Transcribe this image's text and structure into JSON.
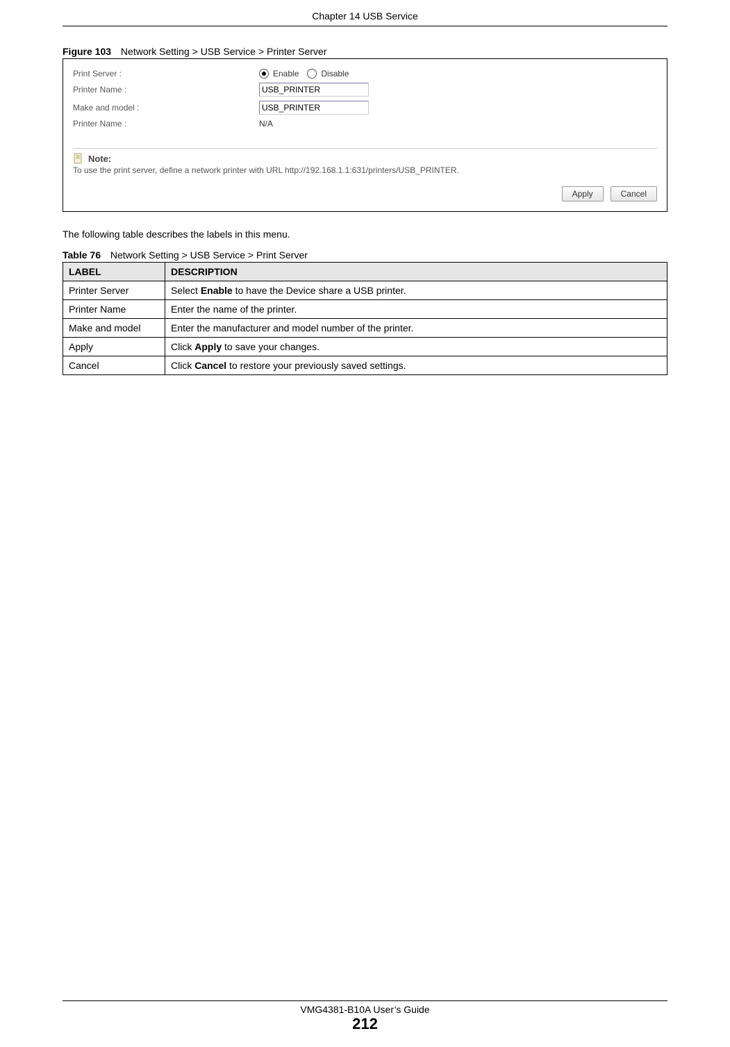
{
  "header": {
    "chapter_title": "Chapter 14 USB Service"
  },
  "figure_caption": {
    "label": "Figure 103",
    "text": "Network Setting > USB Service > Printer Server"
  },
  "form": {
    "row1_label": "Print Server :",
    "radio_enable": "Enable",
    "radio_disable": "Disable",
    "row2_label": "Printer Name :",
    "row2_value": "USB_PRINTER",
    "row3_label": "Make and model :",
    "row3_value": "USB_PRINTER",
    "row4_label": "Printer Name :",
    "row4_value": "N/A"
  },
  "note": {
    "heading": "Note:",
    "text": "To use the print server, define a network printer with URL http://192.168.1.1:631/printers/USB_PRINTER."
  },
  "buttons": {
    "apply": "Apply",
    "cancel": "Cancel"
  },
  "para": "The following table describes the labels in this menu.",
  "table_caption": {
    "label": "Table 76",
    "text": "Network Setting > USB Service > Print Server"
  },
  "table": {
    "head_label": "LABEL",
    "head_desc": "DESCRIPTION",
    "rows": [
      {
        "label": "Printer Server",
        "desc_pre": "Select ",
        "desc_bold": "Enable",
        "desc_post": " to have the Device share a USB printer."
      },
      {
        "label": "Printer Name",
        "desc_pre": "Enter the name of the printer.",
        "desc_bold": "",
        "desc_post": ""
      },
      {
        "label": "Make and model",
        "desc_pre": "Enter the manufacturer and model number of the printer.",
        "desc_bold": "",
        "desc_post": ""
      },
      {
        "label": "Apply",
        "desc_pre": "Click ",
        "desc_bold": "Apply",
        "desc_post": " to save your changes."
      },
      {
        "label": "Cancel",
        "desc_pre": "Click ",
        "desc_bold": "Cancel",
        "desc_post": " to restore your previously saved settings."
      }
    ]
  },
  "footer": {
    "guide": "VMG4381-B10A User’s Guide",
    "page": "212"
  }
}
